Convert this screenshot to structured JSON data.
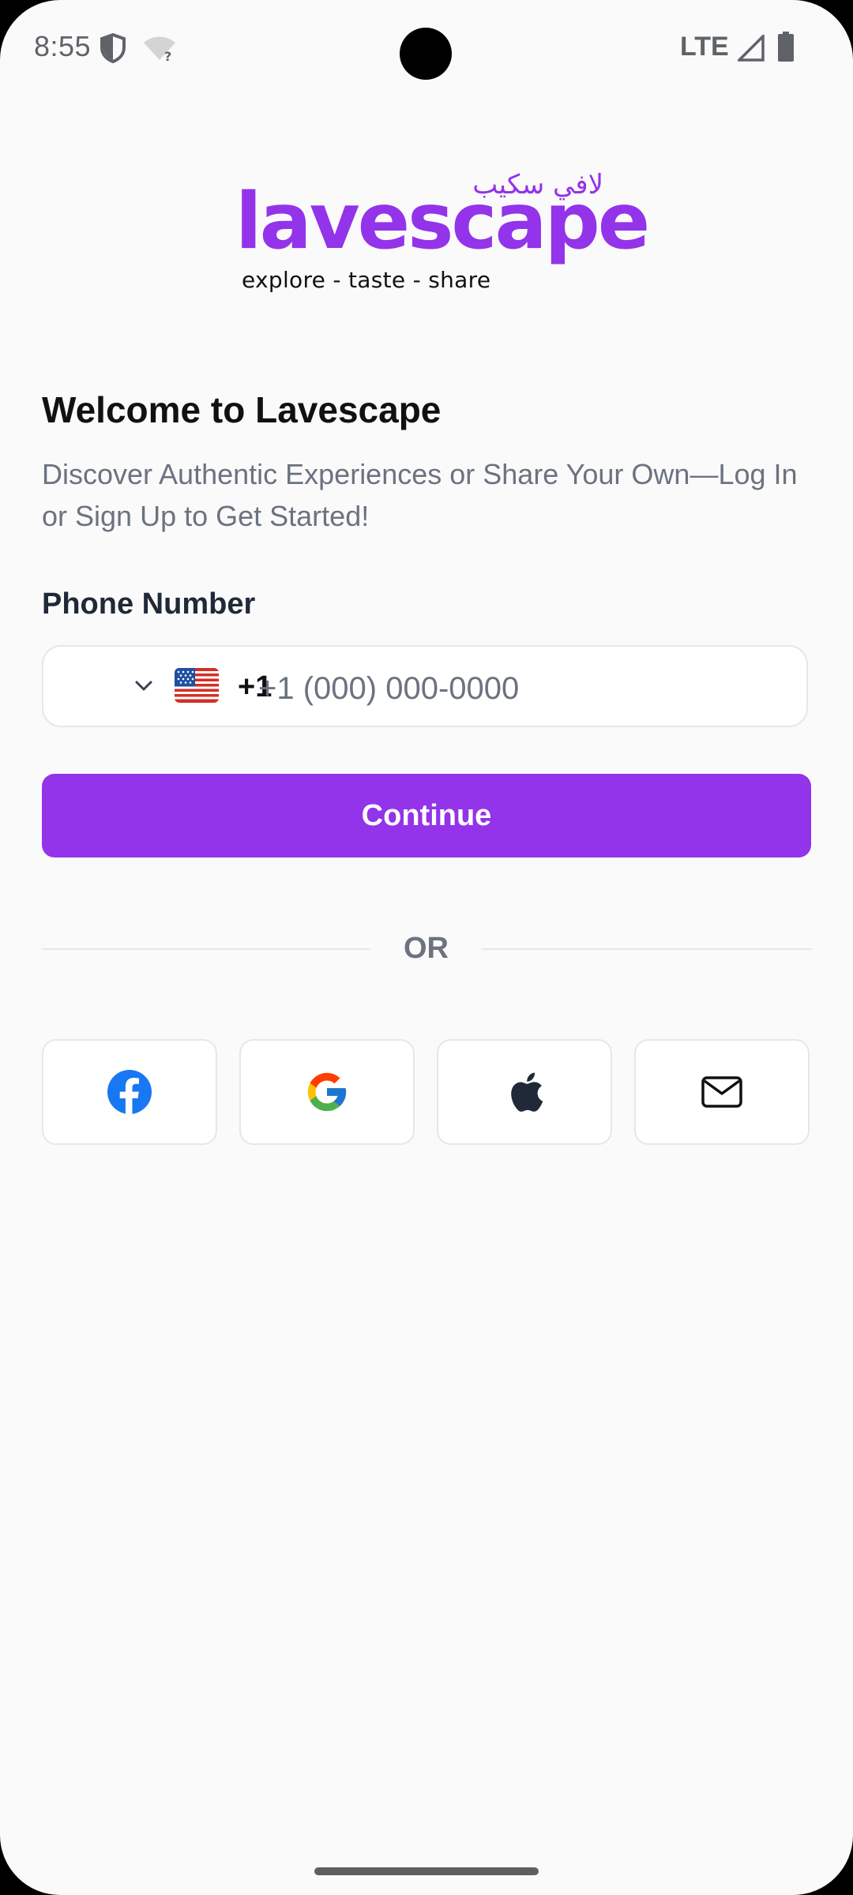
{
  "status_bar": {
    "time": "8:55",
    "network": "LTE",
    "icons": [
      "shield-icon",
      "wifi-unknown-icon",
      "signal-icon",
      "battery-icon"
    ]
  },
  "logo": {
    "arabic": "لافي سكيب",
    "wordmark": "lavescape",
    "tagline": "explore - taste - share",
    "color": "#9333ea"
  },
  "welcome": {
    "title": "Welcome to Lavescape",
    "subtitle": "Discover Authentic Experiences or Share Your Own—Log In or Sign Up to Get Started!"
  },
  "phone": {
    "label": "Phone Number",
    "country_flag": "us-flag-icon",
    "dial_code": "+1",
    "placeholder": "+1 (000) 000-0000",
    "value": ""
  },
  "continue_button": {
    "label": "Continue",
    "color": "#9333ea"
  },
  "divider": {
    "label": "OR"
  },
  "social_logins": [
    {
      "name": "facebook-icon"
    },
    {
      "name": "google-icon"
    },
    {
      "name": "apple-icon"
    },
    {
      "name": "email-icon"
    }
  ]
}
